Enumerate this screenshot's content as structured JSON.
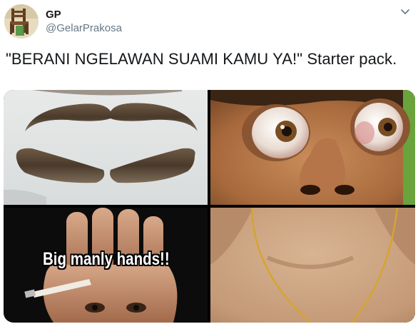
{
  "tweet": {
    "display_name": "GP",
    "handle": "@GelarPrakosa",
    "text": "\"BERANI NGELAWAN SUAMI KAMU YA!\" Starter pack.",
    "avatar_icon": "chair-avatar-icon",
    "menu_icon": "chevron-down-icon"
  },
  "media": {
    "images": [
      {
        "name": "mustache-photo"
      },
      {
        "name": "bulging-eyes-photo"
      },
      {
        "name": "big-hands-photo",
        "caption": "Big manly hands!!"
      },
      {
        "name": "gold-necklace-photo"
      }
    ]
  },
  "colors": {
    "text_primary": "#14171a",
    "text_secondary": "#657786"
  }
}
